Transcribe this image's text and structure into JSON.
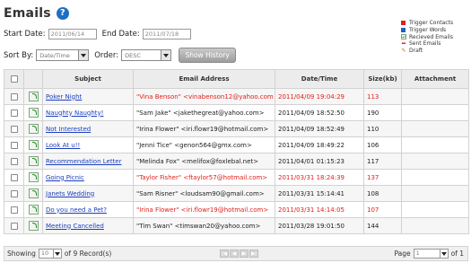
{
  "title": "Emails",
  "legend": [
    {
      "label": "Trigger Contacts",
      "color": "#e0201a",
      "icon": "red-square-icon"
    },
    {
      "label": "Trigger Words",
      "color": "#1e5fc3",
      "icon": "blue-square-icon"
    },
    {
      "label": "Recieved Emails",
      "color": "#2a8a2a",
      "icon": "received-email-icon"
    },
    {
      "label": "Sent Emails",
      "color": "#d02020",
      "icon": "sent-email-icon"
    },
    {
      "label": "Draft",
      "color": "#c07a10",
      "icon": "draft-icon"
    }
  ],
  "filters": {
    "start_label": "Start Date:",
    "start_value": "2011/06/14",
    "end_label": "End Date:",
    "end_value": "2011/07/18",
    "sort_label": "Sort By:",
    "sort_value": "Date/Time",
    "order_label": "Order:",
    "order_value": "DESC",
    "show_history": "Show History"
  },
  "table": {
    "columns": [
      "Subject",
      "Email Address",
      "Date/Time",
      "Size(kb)",
      "Attachment"
    ],
    "rows": [
      {
        "subject": "Poker Night",
        "email": "\"Vina Benson\" <vinabenson12@yahoo.com",
        "datetime": "2011/04/09 19:04:29",
        "size": "113",
        "trigger": true
      },
      {
        "subject": "Naughty Naughty!",
        "email": "\"Sam Jake\" <jakethegreat@yahoo.com>",
        "datetime": "2011/04/09 18:52:50",
        "size": "190",
        "trigger": false
      },
      {
        "subject": "Not Interested",
        "email": "\"Irina Flower\" <iri.flowr19@hotmail.com>",
        "datetime": "2011/04/09 18:52:49",
        "size": "110",
        "trigger": false
      },
      {
        "subject": "Look At u!!",
        "email": "\"Jenni Tice\" <genon564@gmx.com>",
        "datetime": "2011/04/09 18:49:22",
        "size": "106",
        "trigger": false
      },
      {
        "subject": "Recommendation Letter",
        "email": "\"Melinda Fox\" <melifox@foxlebal.net>",
        "datetime": "2011/04/01 01:15:23",
        "size": "117",
        "trigger": false
      },
      {
        "subject": "Going Picnic",
        "email": "\"Taylor Fisher\" <ftaylor57@hotmail.com>",
        "datetime": "2011/03/31 18:24:39",
        "size": "137",
        "trigger": true
      },
      {
        "subject": "Janets Wedding",
        "email": "\"Sam Risner\" <loudsam90@gmail.com>",
        "datetime": "2011/03/31 15:14:41",
        "size": "108",
        "trigger": false
      },
      {
        "subject": "Do you need a Pet?",
        "email": "\"Irina Flower\" <iri.flowr19@hotmail.com>",
        "datetime": "2011/03/31 14:14:05",
        "size": "107",
        "trigger": true
      },
      {
        "subject": "Meeting Cancelled",
        "email": "\"Tim Swan\" <timswan20@yahoo.com>",
        "datetime": "2011/03/28 19:01:50",
        "size": "144",
        "trigger": false
      }
    ]
  },
  "pager": {
    "showing_label": "Showing",
    "page_size": "10",
    "records_text": "of 9 Record(s)",
    "page_label": "Page",
    "page_value": "1",
    "of_text": "of 1"
  }
}
